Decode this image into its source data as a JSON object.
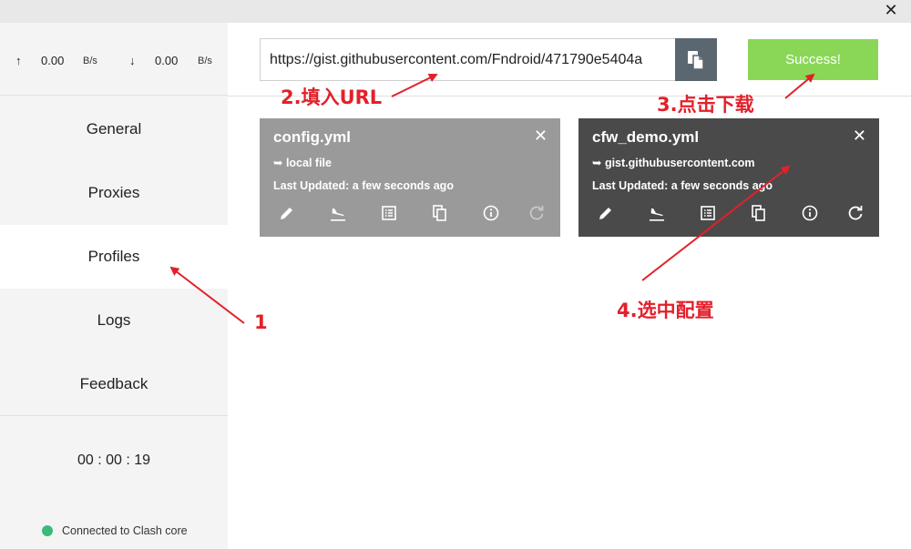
{
  "window": {
    "close_glyph": "✕"
  },
  "traffic": {
    "up_arrow": "↑",
    "up_value": "0.00",
    "up_unit": "B/s",
    "down_arrow": "↓",
    "down_value": "0.00",
    "down_unit": "B/s"
  },
  "sidebar": {
    "items": [
      {
        "label": "General"
      },
      {
        "label": "Proxies"
      },
      {
        "label": "Profiles"
      },
      {
        "label": "Logs"
      },
      {
        "label": "Feedback"
      }
    ],
    "active": "Profiles",
    "timer": "00 : 00 : 19",
    "status": "Connected to Clash core",
    "status_color": "#3cba7a"
  },
  "url_bar": {
    "value": "https://gist.githubusercontent.com/Fndroid/471790e5404a"
  },
  "download_button": {
    "label": "Success!",
    "color": "#8ad758"
  },
  "profiles": [
    {
      "name": "config.yml",
      "source": "➥ local file",
      "updated": "Last Updated: a few seconds ago",
      "selected": false
    },
    {
      "name": "cfw_demo.yml",
      "source": "➥ gist.githubusercontent.com",
      "updated": "Last Updated: a few seconds ago",
      "selected": true
    }
  ],
  "annotations": {
    "step1": "1",
    "step2": "2.填入URL",
    "step3": "3.点击下载",
    "step4": "4.选中配置",
    "color": "#e3202a"
  },
  "icons": [
    "pencil-icon",
    "plane-landing-icon",
    "list-icon",
    "copy-icon",
    "info-icon",
    "refresh-icon"
  ]
}
